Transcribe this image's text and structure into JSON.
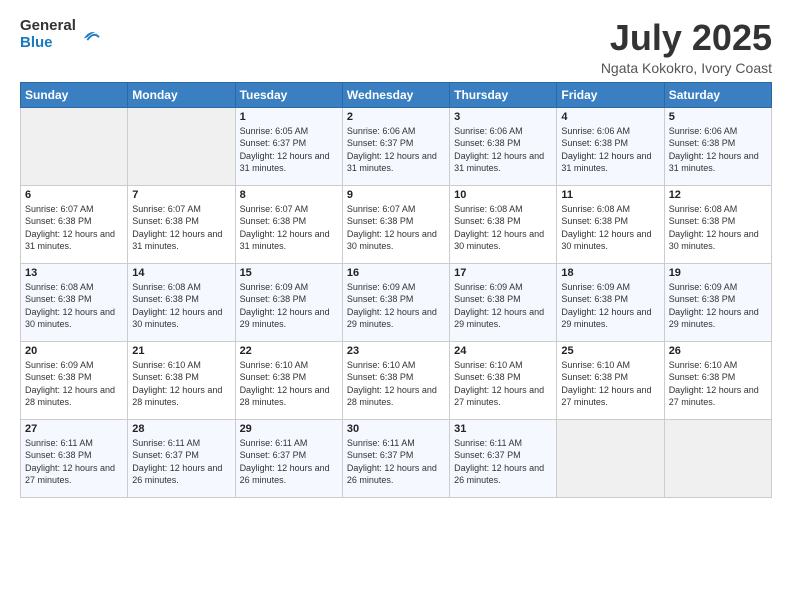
{
  "logo": {
    "general": "General",
    "blue": "Blue"
  },
  "title": "July 2025",
  "subtitle": "Ngata Kokokro, Ivory Coast",
  "days_of_week": [
    "Sunday",
    "Monday",
    "Tuesday",
    "Wednesday",
    "Thursday",
    "Friday",
    "Saturday"
  ],
  "weeks": [
    [
      {
        "day": "",
        "info": ""
      },
      {
        "day": "",
        "info": ""
      },
      {
        "day": "1",
        "info": "Sunrise: 6:05 AM\nSunset: 6:37 PM\nDaylight: 12 hours and 31 minutes."
      },
      {
        "day": "2",
        "info": "Sunrise: 6:06 AM\nSunset: 6:37 PM\nDaylight: 12 hours and 31 minutes."
      },
      {
        "day": "3",
        "info": "Sunrise: 6:06 AM\nSunset: 6:38 PM\nDaylight: 12 hours and 31 minutes."
      },
      {
        "day": "4",
        "info": "Sunrise: 6:06 AM\nSunset: 6:38 PM\nDaylight: 12 hours and 31 minutes."
      },
      {
        "day": "5",
        "info": "Sunrise: 6:06 AM\nSunset: 6:38 PM\nDaylight: 12 hours and 31 minutes."
      }
    ],
    [
      {
        "day": "6",
        "info": "Sunrise: 6:07 AM\nSunset: 6:38 PM\nDaylight: 12 hours and 31 minutes."
      },
      {
        "day": "7",
        "info": "Sunrise: 6:07 AM\nSunset: 6:38 PM\nDaylight: 12 hours and 31 minutes."
      },
      {
        "day": "8",
        "info": "Sunrise: 6:07 AM\nSunset: 6:38 PM\nDaylight: 12 hours and 31 minutes."
      },
      {
        "day": "9",
        "info": "Sunrise: 6:07 AM\nSunset: 6:38 PM\nDaylight: 12 hours and 30 minutes."
      },
      {
        "day": "10",
        "info": "Sunrise: 6:08 AM\nSunset: 6:38 PM\nDaylight: 12 hours and 30 minutes."
      },
      {
        "day": "11",
        "info": "Sunrise: 6:08 AM\nSunset: 6:38 PM\nDaylight: 12 hours and 30 minutes."
      },
      {
        "day": "12",
        "info": "Sunrise: 6:08 AM\nSunset: 6:38 PM\nDaylight: 12 hours and 30 minutes."
      }
    ],
    [
      {
        "day": "13",
        "info": "Sunrise: 6:08 AM\nSunset: 6:38 PM\nDaylight: 12 hours and 30 minutes."
      },
      {
        "day": "14",
        "info": "Sunrise: 6:08 AM\nSunset: 6:38 PM\nDaylight: 12 hours and 30 minutes."
      },
      {
        "day": "15",
        "info": "Sunrise: 6:09 AM\nSunset: 6:38 PM\nDaylight: 12 hours and 29 minutes."
      },
      {
        "day": "16",
        "info": "Sunrise: 6:09 AM\nSunset: 6:38 PM\nDaylight: 12 hours and 29 minutes."
      },
      {
        "day": "17",
        "info": "Sunrise: 6:09 AM\nSunset: 6:38 PM\nDaylight: 12 hours and 29 minutes."
      },
      {
        "day": "18",
        "info": "Sunrise: 6:09 AM\nSunset: 6:38 PM\nDaylight: 12 hours and 29 minutes."
      },
      {
        "day": "19",
        "info": "Sunrise: 6:09 AM\nSunset: 6:38 PM\nDaylight: 12 hours and 29 minutes."
      }
    ],
    [
      {
        "day": "20",
        "info": "Sunrise: 6:09 AM\nSunset: 6:38 PM\nDaylight: 12 hours and 28 minutes."
      },
      {
        "day": "21",
        "info": "Sunrise: 6:10 AM\nSunset: 6:38 PM\nDaylight: 12 hours and 28 minutes."
      },
      {
        "day": "22",
        "info": "Sunrise: 6:10 AM\nSunset: 6:38 PM\nDaylight: 12 hours and 28 minutes."
      },
      {
        "day": "23",
        "info": "Sunrise: 6:10 AM\nSunset: 6:38 PM\nDaylight: 12 hours and 28 minutes."
      },
      {
        "day": "24",
        "info": "Sunrise: 6:10 AM\nSunset: 6:38 PM\nDaylight: 12 hours and 27 minutes."
      },
      {
        "day": "25",
        "info": "Sunrise: 6:10 AM\nSunset: 6:38 PM\nDaylight: 12 hours and 27 minutes."
      },
      {
        "day": "26",
        "info": "Sunrise: 6:10 AM\nSunset: 6:38 PM\nDaylight: 12 hours and 27 minutes."
      }
    ],
    [
      {
        "day": "27",
        "info": "Sunrise: 6:11 AM\nSunset: 6:38 PM\nDaylight: 12 hours and 27 minutes."
      },
      {
        "day": "28",
        "info": "Sunrise: 6:11 AM\nSunset: 6:37 PM\nDaylight: 12 hours and 26 minutes."
      },
      {
        "day": "29",
        "info": "Sunrise: 6:11 AM\nSunset: 6:37 PM\nDaylight: 12 hours and 26 minutes."
      },
      {
        "day": "30",
        "info": "Sunrise: 6:11 AM\nSunset: 6:37 PM\nDaylight: 12 hours and 26 minutes."
      },
      {
        "day": "31",
        "info": "Sunrise: 6:11 AM\nSunset: 6:37 PM\nDaylight: 12 hours and 26 minutes."
      },
      {
        "day": "",
        "info": ""
      },
      {
        "day": "",
        "info": ""
      }
    ]
  ]
}
